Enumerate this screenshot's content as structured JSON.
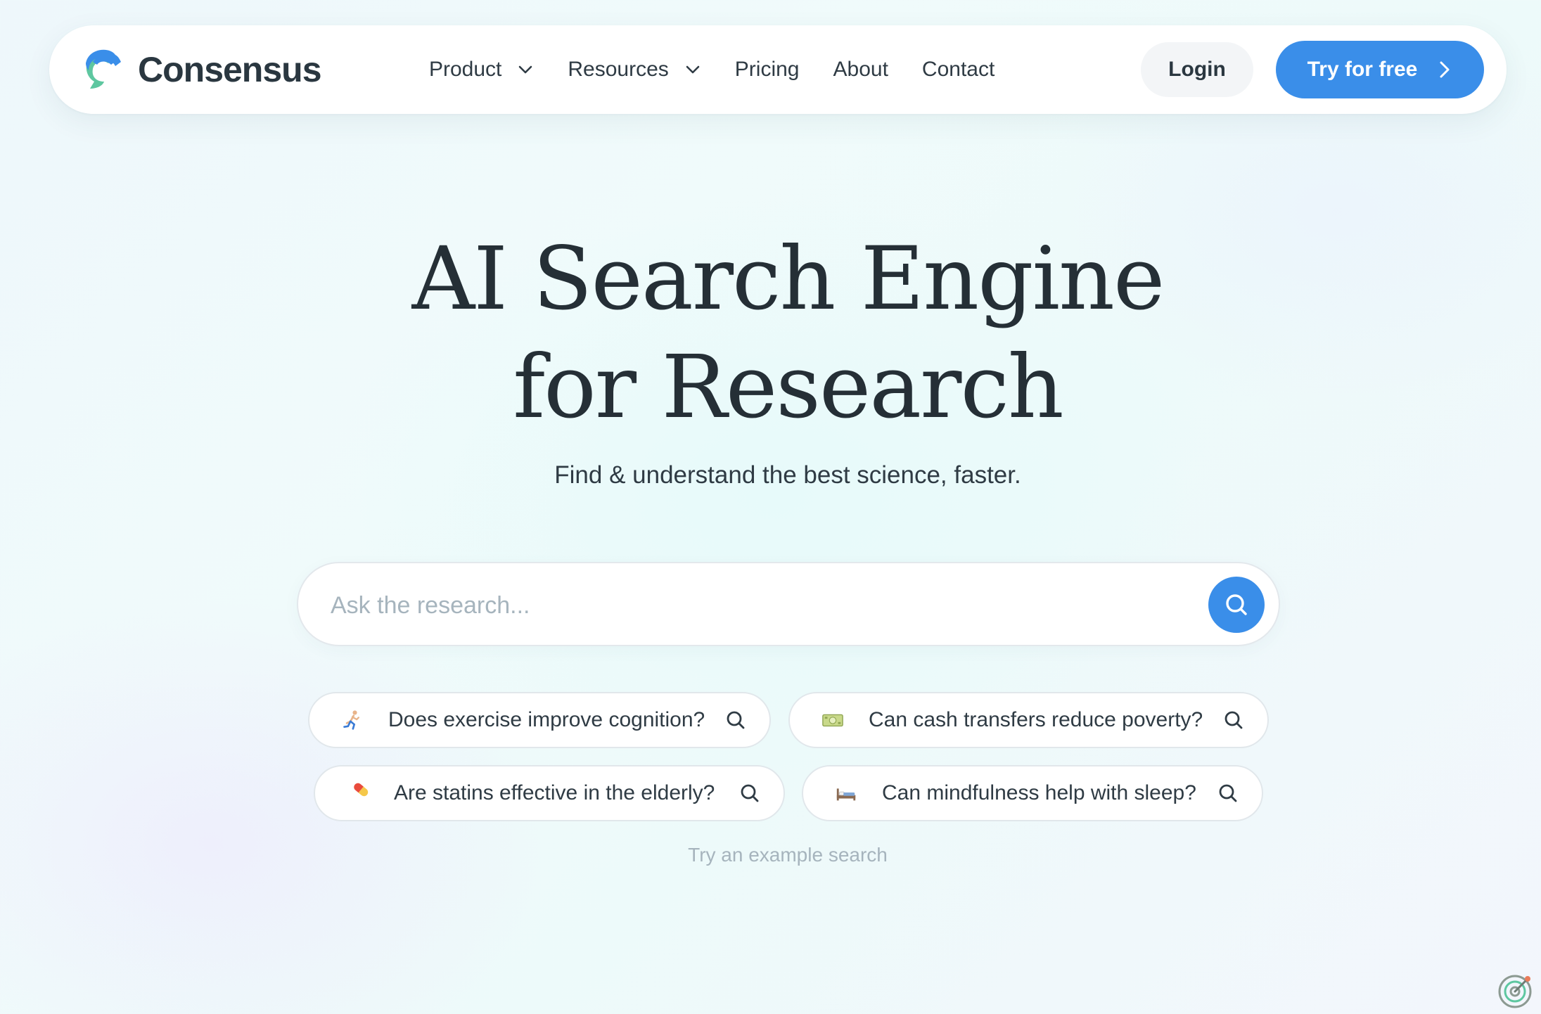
{
  "brand": {
    "name": "Consensus",
    "colors": {
      "primary": "#3a8ee9",
      "accent_green": "#5ec7a0",
      "text": "#2a3740"
    }
  },
  "nav": {
    "items": [
      {
        "label": "Product",
        "has_dropdown": true
      },
      {
        "label": "Resources",
        "has_dropdown": true
      },
      {
        "label": "Pricing",
        "has_dropdown": false
      },
      {
        "label": "About",
        "has_dropdown": false
      },
      {
        "label": "Contact",
        "has_dropdown": false
      }
    ],
    "login_label": "Login",
    "try_label": "Try for free"
  },
  "hero": {
    "title_line1": "AI Search Engine",
    "title_line2": "for Research",
    "subtitle": "Find & understand the best science, faster."
  },
  "search": {
    "placeholder": "Ask the research...",
    "value": ""
  },
  "examples": {
    "chips": [
      {
        "emoji": "running-person-icon",
        "label": "Does exercise improve cognition?"
      },
      {
        "emoji": "banknote-icon",
        "label": "Can cash transfers reduce poverty?"
      },
      {
        "emoji": "pill-icon",
        "label": "Are statins effective in the elderly?"
      },
      {
        "emoji": "bed-icon",
        "label": "Can mindfulness help with sleep?"
      }
    ],
    "hint": "Try an example search"
  }
}
